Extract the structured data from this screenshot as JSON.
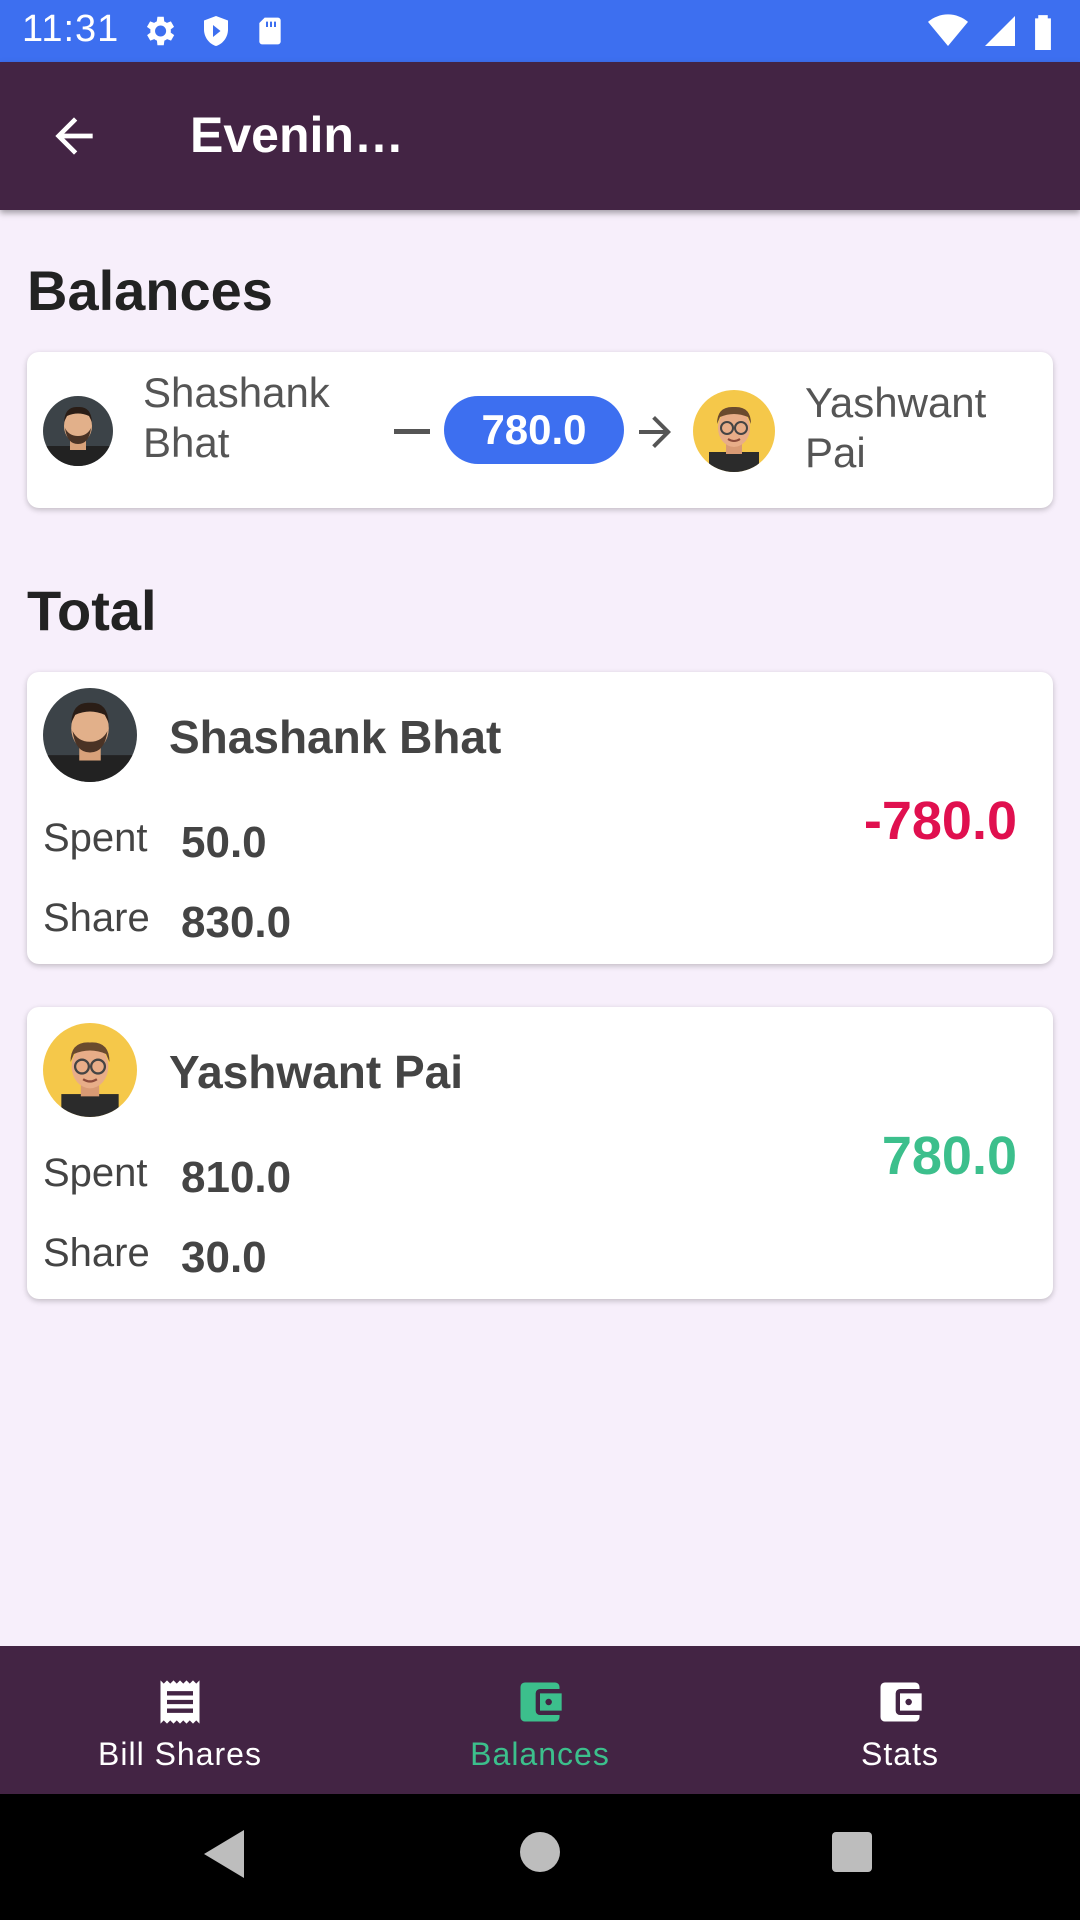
{
  "status": {
    "time": "11:31"
  },
  "app_bar": {
    "title": "Evenin…"
  },
  "balances": {
    "heading": "Balances",
    "from_name": "Shashank Bhat",
    "amount": "780.0",
    "to_name": "Yashwant Pai"
  },
  "total": {
    "heading": "Total",
    "people": [
      {
        "name": "Shashank Bhat",
        "spent_label": "Spent",
        "spent": "50.0",
        "share_label": "Share",
        "share": "830.0",
        "net": "-780.0",
        "net_color": "#e0104f"
      },
      {
        "name": "Yashwant Pai",
        "spent_label": "Spent",
        "spent": "810.0",
        "share_label": "Share",
        "share": "30.0",
        "net": "780.0",
        "net_color": "#3cbf8c"
      }
    ]
  },
  "bottom_nav": {
    "items": [
      {
        "label": "Bill Shares",
        "icon": "receipt-icon"
      },
      {
        "label": "Balances",
        "icon": "wallet-icon",
        "active": true
      },
      {
        "label": "Stats",
        "icon": "wallet-icon"
      }
    ]
  },
  "colors": {
    "status_bar": "#3d6ff0",
    "app_bar": "#432444",
    "accent": "#3cbf8c",
    "amount_pill": "#3d6ff0",
    "negative": "#e0104f",
    "positive": "#3cbf8c"
  }
}
